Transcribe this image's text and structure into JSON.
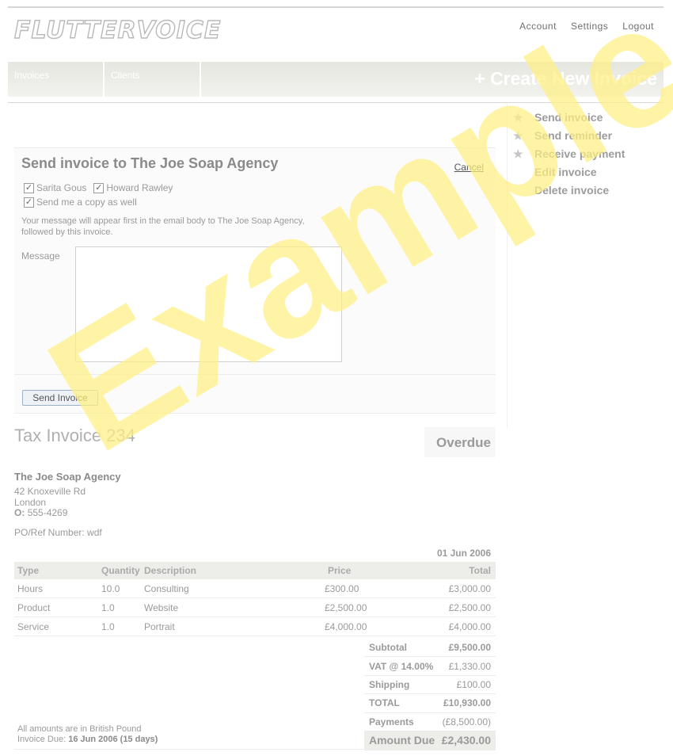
{
  "brand": {
    "logo_text": "FLUTTERVOICE"
  },
  "top_nav": {
    "account": "Account",
    "settings": "Settings",
    "logout": "Logout"
  },
  "nav": {
    "invoices": "Invoices",
    "clients": "Clients",
    "create": "+ Create New Invoice"
  },
  "sidebar": {
    "items": [
      {
        "label": "Send invoice",
        "icon": "star-icon"
      },
      {
        "label": "Send reminder",
        "icon": "star-icon"
      },
      {
        "label": "Receive payment",
        "icon": "star-icon"
      },
      {
        "label": "Edit invoice",
        "icon": ""
      },
      {
        "label": "Delete invoice",
        "icon": ""
      }
    ]
  },
  "send_panel": {
    "title": "Send invoice to The Joe Soap Agency",
    "cancel": "Cancel",
    "recipients": [
      {
        "label": "Sarita Gous",
        "checked": true
      },
      {
        "label": "Howard Rawley",
        "checked": true
      }
    ],
    "copy_self": {
      "label": "Send me a copy as well",
      "checked": true
    },
    "note": "Your message will appear first in the email body to The Joe Soap Agency, followed by this invoice.",
    "message_label": "Message",
    "message_value": "",
    "send_button": "Send Invoice"
  },
  "invoice": {
    "title": "Tax Invoice 234",
    "status": "Overdue",
    "client": {
      "name": "The Joe Soap Agency",
      "address_line1": "42 Knoxeville Rd",
      "address_line2": "London",
      "phone_label": "O:",
      "phone": "555-4269"
    },
    "po_ref": "PO/Ref Number: wdf",
    "date": "01 Jun 2006",
    "columns": {
      "type": "Type",
      "quantity": "Quantity",
      "description": "Description",
      "price": "Price",
      "total": "Total"
    },
    "lines": [
      {
        "type": "Hours",
        "quantity": "10.0",
        "description": "Consulting",
        "price": "£300.00",
        "total": "£3,000.00"
      },
      {
        "type": "Product",
        "quantity": "1.0",
        "description": "Website",
        "price": "£2,500.00",
        "total": "£2,500.00"
      },
      {
        "type": "Service",
        "quantity": "1.0",
        "description": "Portrait",
        "price": "£4,000.00",
        "total": "£4,000.00"
      }
    ],
    "totals": {
      "subtotal_label": "Subtotal",
      "subtotal": "£9,500.00",
      "vat_label": "VAT @ 14.00%",
      "vat": "£1,330.00",
      "shipping_label": "Shipping",
      "shipping": "£100.00",
      "total_label": "TOTAL",
      "total": "£10,930.00",
      "payments_label": "Payments",
      "payments": "(£8,500.00)",
      "amount_due_label": "Amount Due",
      "amount_due": "£2,430.00"
    },
    "currency_note": "All amounts are in British Pound",
    "due_label": "Invoice Due:",
    "due_value": "16 Jun 2006 (15 days)"
  },
  "watermark": "Example"
}
